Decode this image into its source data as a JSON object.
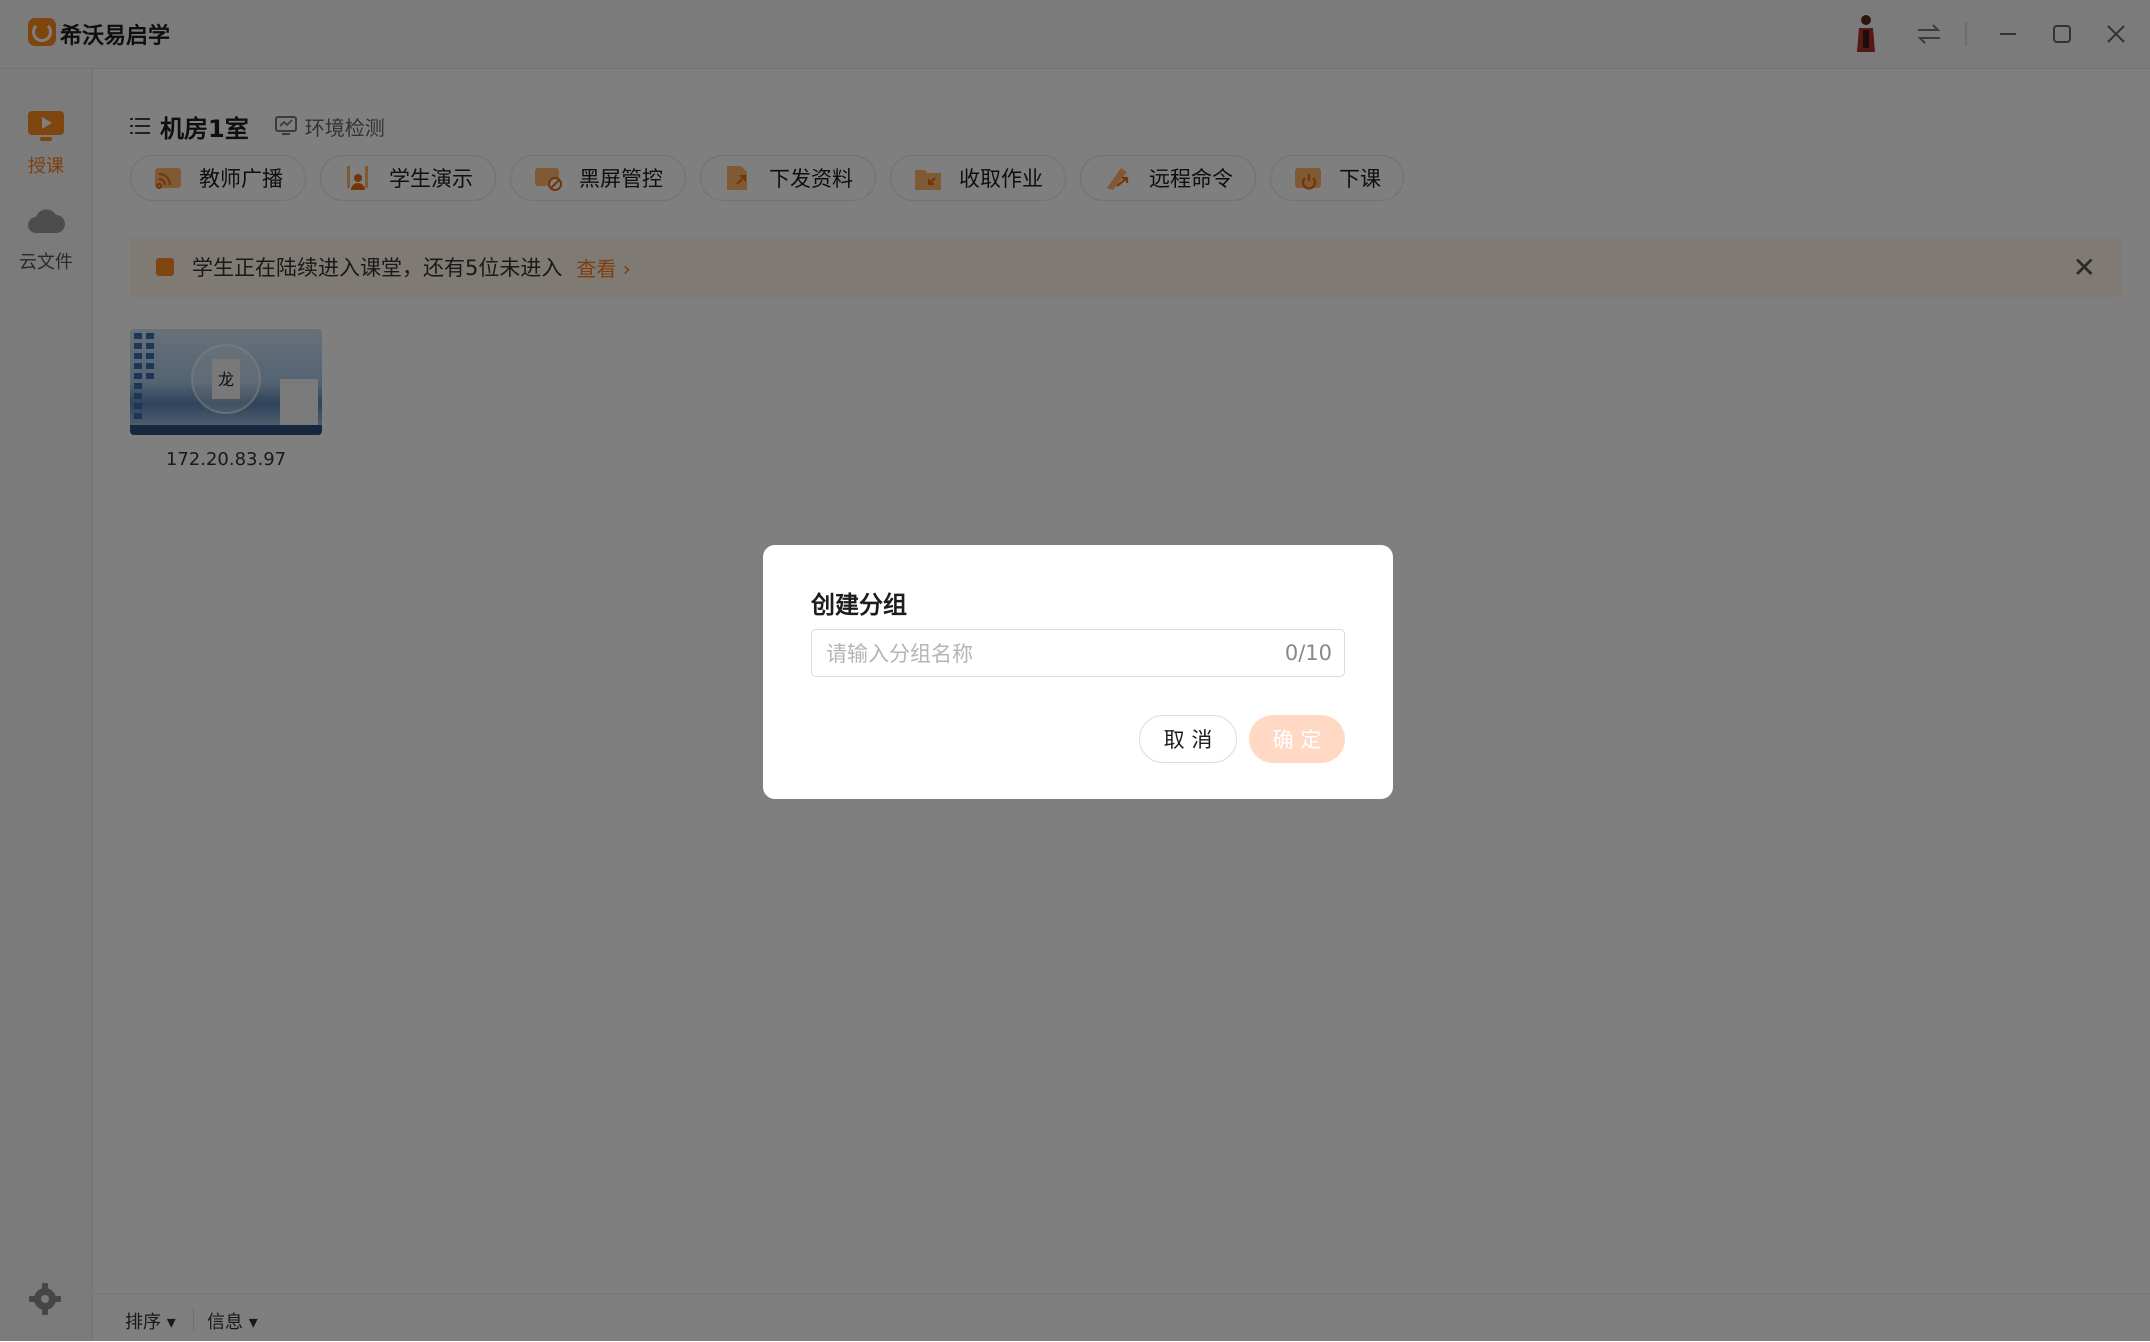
{
  "app": {
    "title": "希沃易启学",
    "accent": "#ff8a1f"
  },
  "titlebar": {
    "icons": [
      "avatar-icon",
      "switch-icon",
      "minimize-icon",
      "maximize-icon",
      "close-icon"
    ]
  },
  "sidebar": {
    "items": [
      {
        "label": "授课",
        "icon": "teach-icon",
        "active": true
      },
      {
        "label": "云文件",
        "icon": "cloud-icon",
        "active": false
      }
    ],
    "settings_icon": "gear-icon"
  },
  "room": {
    "title": "机房1室",
    "env_check": "环境检测"
  },
  "toolbar": {
    "buttons": [
      {
        "label": "教师广播",
        "icon": "broadcast-icon"
      },
      {
        "label": "学生演示",
        "icon": "student-demo-icon"
      },
      {
        "label": "黑屏管控",
        "icon": "black-screen-icon"
      },
      {
        "label": "下发资料",
        "icon": "send-file-icon"
      },
      {
        "label": "收取作业",
        "icon": "collect-homework-icon"
      },
      {
        "label": "远程命令",
        "icon": "remote-command-icon"
      },
      {
        "label": "下课",
        "icon": "end-class-icon"
      }
    ]
  },
  "banner": {
    "text": "学生正在陆续进入课堂，还有5位未进入",
    "link": "查看 ›",
    "background": "#fff4e6"
  },
  "students": [
    {
      "ip": "172.20.83.97"
    }
  ],
  "bottombar": {
    "sort": "排序 ▾",
    "info": "信息 ▾"
  },
  "dialog": {
    "title": "创建分组",
    "input_placeholder": "请输入分组名称",
    "input_value": "",
    "counter": "0/10",
    "cancel": "取 消",
    "confirm": "确 定"
  }
}
